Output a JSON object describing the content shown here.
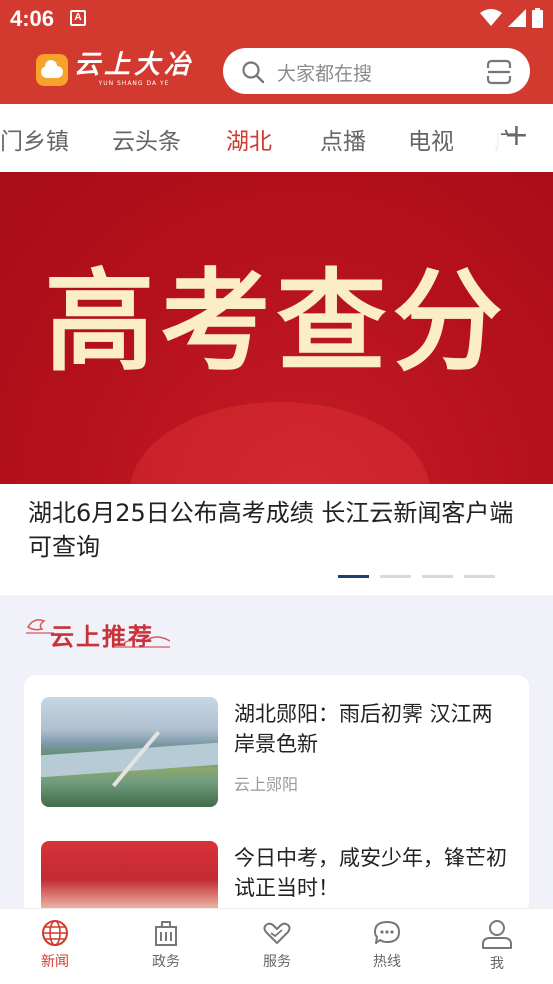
{
  "status": {
    "time": "4:06",
    "notification_badge": "A"
  },
  "app": {
    "logo_title": "云上大冶",
    "logo_subtitle": "YUN SHANG DA YE",
    "brand_color": "#d33a2f"
  },
  "search": {
    "placeholder": "大家都在搜"
  },
  "tabs": [
    {
      "label": "门乡镇"
    },
    {
      "label": "云头条"
    },
    {
      "label": "湖北",
      "active": true
    },
    {
      "label": "点播"
    },
    {
      "label": "电视"
    },
    {
      "label": "广"
    }
  ],
  "add_tab_label": "+",
  "banner": {
    "image_text": "高考查分",
    "caption": "湖北6月25日公布高考成绩 长江云新闻客户端可查询",
    "active_slide": 1,
    "slide_count": 4
  },
  "recommend": {
    "title": "云上推荐",
    "items": [
      {
        "title": "湖北郧阳：雨后初霁 汉江两岸景色新",
        "source": "云上郧阳"
      },
      {
        "title": "今日中考，咸安少年，锋芒初试正当时！"
      }
    ]
  },
  "bottom_nav": [
    {
      "label": "新闻",
      "icon": "globe-icon",
      "active": true
    },
    {
      "label": "政务",
      "icon": "building-icon"
    },
    {
      "label": "服务",
      "icon": "heart-hands-icon"
    },
    {
      "label": "热线",
      "icon": "chat-bubble-icon"
    },
    {
      "label": "我",
      "icon": "person-icon"
    }
  ]
}
